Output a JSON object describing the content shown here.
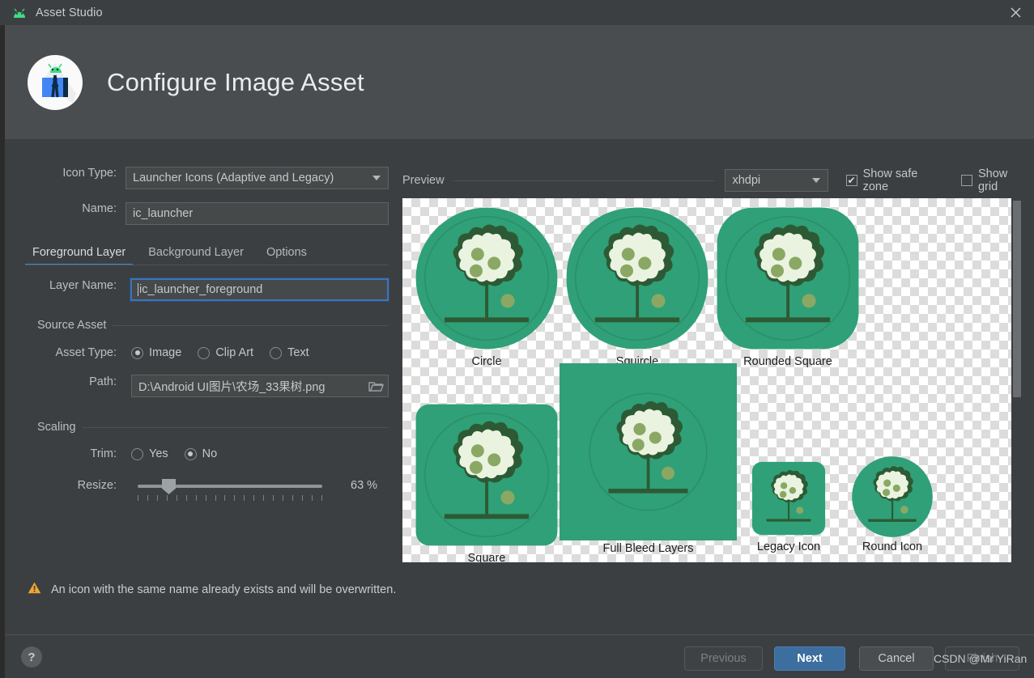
{
  "window": {
    "title": "Asset Studio",
    "app_icon": "android-robot-icon",
    "close_icon": "close-icon"
  },
  "header": {
    "icon": "android-studio-icon",
    "title": "Configure Image Asset"
  },
  "form": {
    "icon_type": {
      "label": "Icon Type:",
      "value": "Launcher Icons (Adaptive and Legacy)"
    },
    "name": {
      "label": "Name:",
      "value": "ic_launcher"
    },
    "tabs": [
      {
        "label": "Foreground Layer",
        "active": true
      },
      {
        "label": "Background Layer",
        "active": false
      },
      {
        "label": "Options",
        "active": false
      }
    ],
    "layer_name": {
      "label": "Layer Name:",
      "value": "ic_launcher_foreground",
      "focused": true
    },
    "source_asset": {
      "group_label": "Source Asset",
      "asset_type": {
        "label": "Asset Type:",
        "options": [
          {
            "label": "Image",
            "selected": true
          },
          {
            "label": "Clip Art",
            "selected": false
          },
          {
            "label": "Text",
            "selected": false
          }
        ]
      },
      "path": {
        "label": "Path:",
        "value": "D:\\Android UI图片\\农场_33果树.png",
        "browse_icon": "folder-icon"
      }
    },
    "scaling": {
      "group_label": "Scaling",
      "trim": {
        "label": "Trim:",
        "options": [
          {
            "label": "Yes",
            "selected": false
          },
          {
            "label": "No",
            "selected": true
          }
        ]
      },
      "resize": {
        "label": "Resize:",
        "value": "63 %",
        "percent": 63
      }
    }
  },
  "preview": {
    "title": "Preview",
    "density": "xhdpi",
    "show_safe_zone": {
      "label": "Show safe zone",
      "checked": true
    },
    "show_grid": {
      "label": "Show grid",
      "checked": false
    },
    "items": [
      {
        "label": "Circle",
        "shape": "circle"
      },
      {
        "label": "Squircle",
        "shape": "squircle"
      },
      {
        "label": "Rounded Square",
        "shape": "rounded-square"
      },
      {
        "label": "Square",
        "shape": "square"
      },
      {
        "label": "Full Bleed Layers",
        "shape": "full-bleed"
      },
      {
        "label": "Legacy Icon",
        "shape": "legacy"
      },
      {
        "label": "Round Icon",
        "shape": "round"
      }
    ]
  },
  "warning": {
    "icon": "warning-triangle-icon",
    "text": "An icon with the same name already exists and will be overwritten."
  },
  "footer": {
    "help": {
      "label": "?",
      "icon": "help-icon"
    },
    "buttons": [
      {
        "label": "Previous",
        "state": "disabled"
      },
      {
        "label": "Next",
        "state": "primary"
      },
      {
        "label": "Cancel",
        "state": "normal"
      },
      {
        "label": "Finish",
        "state": "disabled"
      }
    ]
  },
  "watermark": {
    "text": "CSDN @Mr YiRan"
  },
  "colors": {
    "window_bg": "#3c3f41",
    "header_bg": "#4a4d4f",
    "field_bg": "#45494a",
    "accent_blue": "#4a88c7",
    "primary_button": "#3c6e9f",
    "warning_amber": "#f0a732",
    "icon_green": "#2fa077",
    "icon_dark_green": "#2d5a34",
    "icon_cream": "#eaf3e0",
    "icon_olive": "#8aa863"
  }
}
